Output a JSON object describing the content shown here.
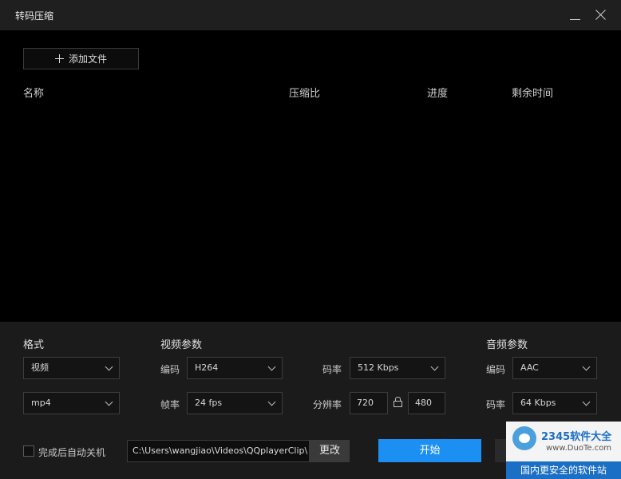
{
  "window": {
    "title": "转码压缩"
  },
  "toolbar": {
    "add_file": "添加文件"
  },
  "list": {
    "columns": [
      "名称",
      "压缩比",
      "进度",
      "剩余时间"
    ]
  },
  "format": {
    "heading": "格式",
    "type_value": "视频",
    "container_value": "mp4"
  },
  "video": {
    "heading": "视频参数",
    "codec_label": "编码",
    "codec_value": "H264",
    "fps_label": "帧率",
    "fps_value": "24 fps",
    "bitrate_label": "码率",
    "bitrate_value": "512 Kbps",
    "resolution_label": "分辨率",
    "width": "720",
    "height": "480"
  },
  "audio": {
    "heading": "音频参数",
    "codec_label": "编码",
    "codec_value": "AAC",
    "bitrate_label": "码率",
    "bitrate_value": "64 Kbps"
  },
  "footer": {
    "shutdown_label": "完成后自动关机",
    "path": "C:\\Users\\wangjiao\\Videos\\QQplayerClip\\",
    "change_label": "更改",
    "start_label": "开始"
  },
  "watermark": {
    "brand": "2345软件大全",
    "url": "www.DuoTe.com",
    "slogan": "国内更安全的软件站"
  },
  "colors": {
    "accent": "#1c8ff3",
    "panel": "#1b1b1b",
    "background": "#000000"
  }
}
